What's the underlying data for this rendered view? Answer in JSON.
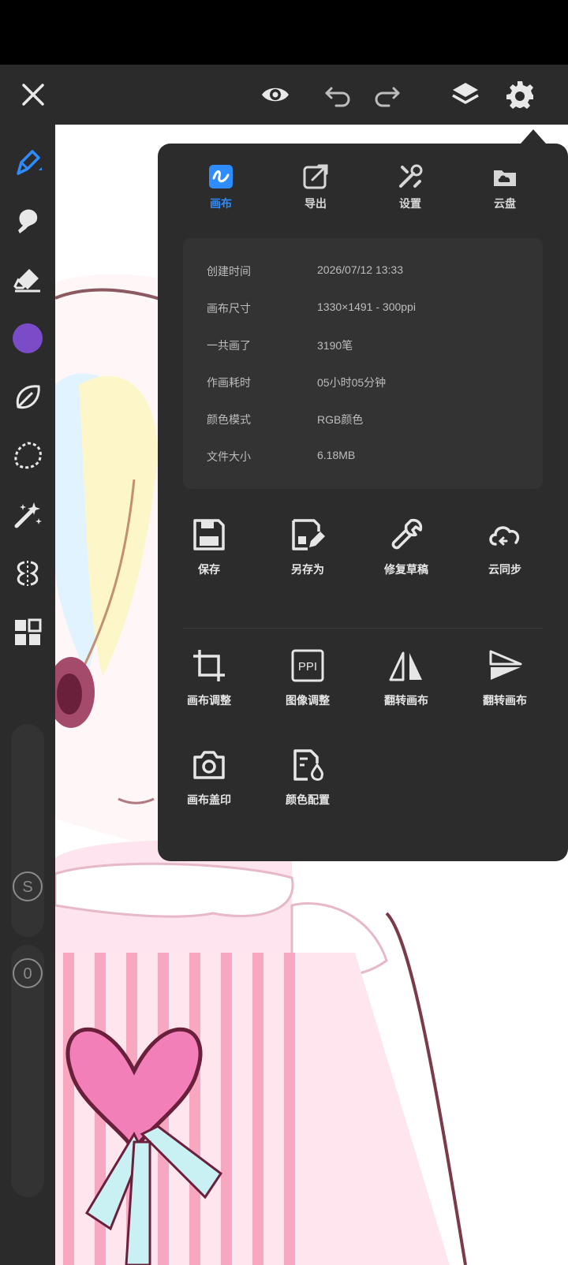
{
  "top_toolbar": {
    "close_icon": "close-icon",
    "eye_icon": "eye-icon",
    "undo_icon": "undo-icon",
    "redo_icon": "redo-icon",
    "layers_icon": "layers-icon",
    "settings_icon": "gear-icon"
  },
  "sidebar": {
    "tools": [
      "pen",
      "smudge",
      "eraser",
      "color",
      "leaf",
      "lasso",
      "magic-wand",
      "symmetry",
      "grid"
    ],
    "active_color": "#7b4cc8",
    "size_label": "S",
    "opacity_label": "0"
  },
  "panel": {
    "tabs": [
      {
        "label": "画布",
        "active": true
      },
      {
        "label": "导出",
        "active": false
      },
      {
        "label": "设置",
        "active": false
      },
      {
        "label": "云盘",
        "active": false
      }
    ],
    "info": [
      {
        "key": "创建时间",
        "value": "2026/07/12 13:33"
      },
      {
        "key": "画布尺寸",
        "value": "1330×1491 - 300ppi"
      },
      {
        "key": "一共画了",
        "value": "3190笔"
      },
      {
        "key": "作画耗时",
        "value": "05小时05分钟"
      },
      {
        "key": "颜色模式",
        "value": "RGB颜色"
      },
      {
        "key": "文件大小",
        "value": "6.18MB"
      }
    ],
    "actions_row1": [
      {
        "label": "保存"
      },
      {
        "label": "另存为"
      },
      {
        "label": "修复草稿"
      },
      {
        "label": "云同步"
      }
    ],
    "actions_row2": [
      {
        "label": "画布调整"
      },
      {
        "label": "图像调整"
      },
      {
        "label": "翻转画布"
      },
      {
        "label": "翻转画布"
      }
    ],
    "actions_row3": [
      {
        "label": "画布盖印"
      },
      {
        "label": "颜色配置"
      }
    ],
    "ppi_icon_text": "PPI"
  },
  "colors": {
    "accent": "#2f8cff",
    "panel_bg": "#2c2c2c",
    "toolbar_bg": "#2b2b2b"
  }
}
